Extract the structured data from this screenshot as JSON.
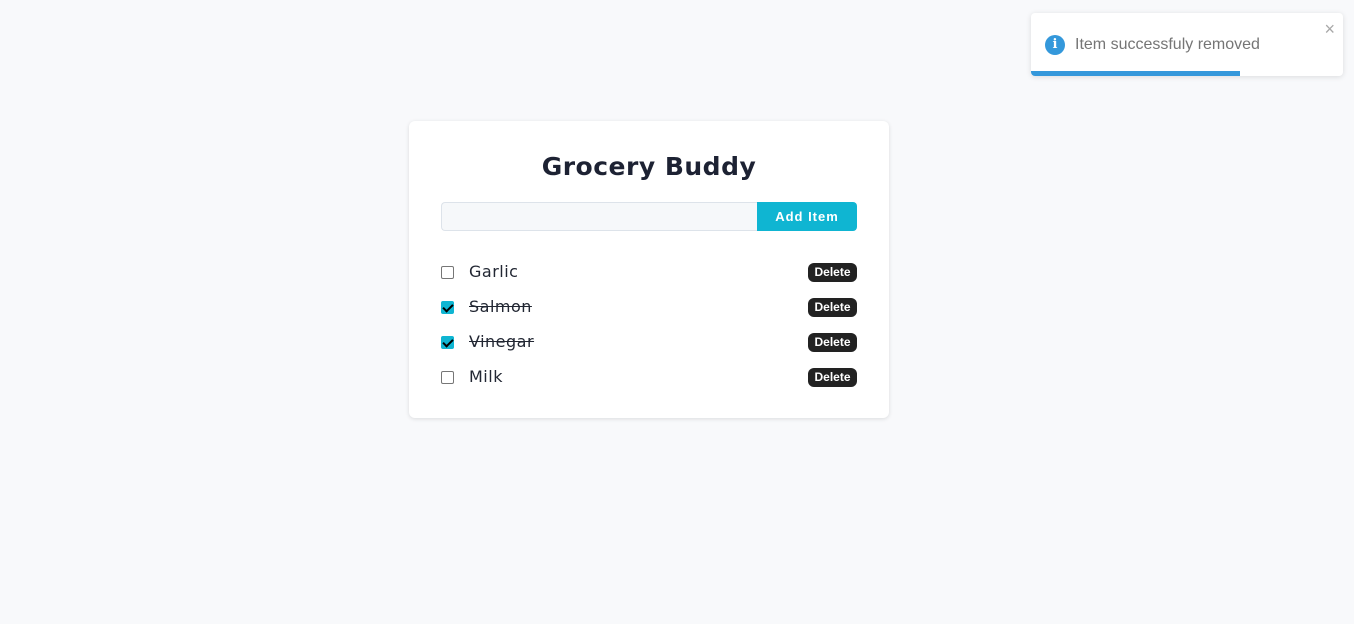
{
  "toast": {
    "icon": "info-icon",
    "icon_glyph": "i",
    "message": "Item successfuly removed",
    "close_glyph": "×",
    "progress": 0.67,
    "color": "#3498db"
  },
  "app": {
    "title": "Grocery Buddy",
    "input": {
      "value": "",
      "placeholder": ""
    },
    "add_label": "Add Item",
    "accent": "#0fb5d2"
  },
  "items": [
    {
      "name": "Garlic",
      "checked": false,
      "delete_label": "Delete"
    },
    {
      "name": "Salmon",
      "checked": true,
      "delete_label": "Delete"
    },
    {
      "name": "Vinegar",
      "checked": true,
      "delete_label": "Delete"
    },
    {
      "name": "Milk",
      "checked": false,
      "delete_label": "Delete"
    }
  ]
}
